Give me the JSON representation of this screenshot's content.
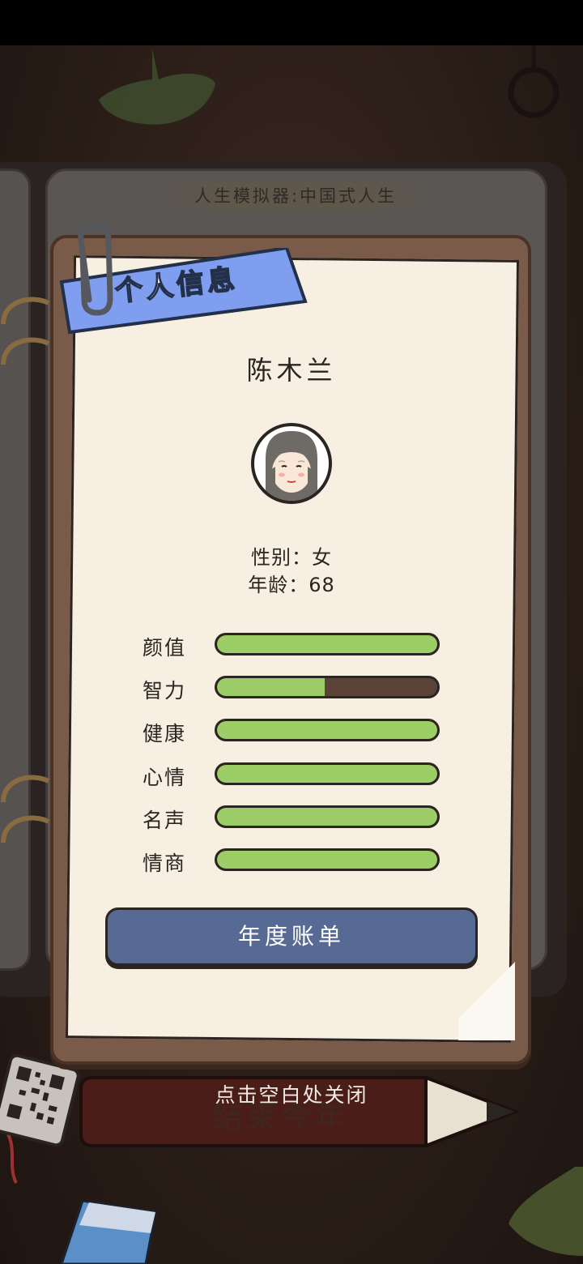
{
  "game": {
    "title": "人生模拟器:中国式人生"
  },
  "panel": {
    "ribbon_title": "个人信息",
    "name": "陈木兰",
    "gender_label": "性别",
    "gender_value": "女",
    "age_label": "年龄",
    "age_value": "68",
    "gender_line": "性别：女",
    "age_line": "年龄：68"
  },
  "stats": [
    {
      "label": "颜值",
      "value_fraction": 1.0
    },
    {
      "label": "智力",
      "value_fraction": 0.49
    },
    {
      "label": "健康",
      "value_fraction": 1.0
    },
    {
      "label": "心情",
      "value_fraction": 1.0
    },
    {
      "label": "名声",
      "value_fraction": 1.0
    },
    {
      "label": "情商",
      "value_fraction": 1.0
    }
  ],
  "actions": {
    "bill_button": "年度账单",
    "end_year_button": "结束今年",
    "close_hint": "点击空白处关闭"
  },
  "colors": {
    "stat_fill": "#9ccd66",
    "stat_track": "#5a4236",
    "ribbon": "#7f9ef0",
    "button": "#566a94",
    "paper": "#f6efe2"
  },
  "icons": {
    "avatar": "elderly-woman-avatar-icon",
    "paperclip": "paperclip-icon",
    "qr": "qr-code-icon"
  }
}
